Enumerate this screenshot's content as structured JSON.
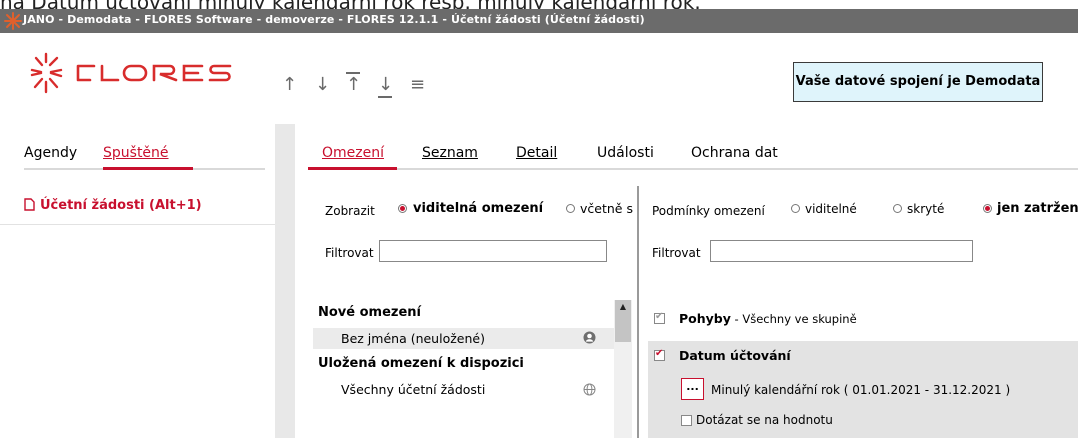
{
  "top_fragment": "na Datum účtování minulý kalendářní rok resp. minulý kalendářní rok.",
  "window": {
    "title": "JANO - Demodata - FLORES Software - demoverze - FLORES 12.1.1 - Účetní žádosti  (Účetní žádosti)"
  },
  "header": {
    "logo_text": "FLORES",
    "toolbar": [
      "up-arrow-icon",
      "down-arrow-icon",
      "move-to-top-icon",
      "move-to-bottom-icon",
      "menu-icon"
    ],
    "connection_label": "Vaše datové spojení je Demodata"
  },
  "left_panel": {
    "tabs": [
      {
        "label": "Agendy",
        "active": false
      },
      {
        "label": "Spuštěné",
        "active": true
      }
    ],
    "running_item": "Účetní žádosti (Alt+1)"
  },
  "main": {
    "tabs": [
      {
        "label": "Omezení",
        "active": true
      },
      {
        "label": "Seznam",
        "active": false
      },
      {
        "label": "Detail",
        "active": false
      },
      {
        "label": "Události",
        "active": false
      },
      {
        "label": "Ochrana dat",
        "active": false
      }
    ],
    "left": {
      "show_label": "Zobrazit",
      "show_options": [
        {
          "label": "viditelná omezení",
          "selected": true
        },
        {
          "label": "včetně s",
          "selected": false
        }
      ],
      "filter_label": "Filtrovat",
      "filter_value": "",
      "list": {
        "group1_title": "Nové omezení",
        "group1_item": "Bez jména (neuložené)",
        "group2_title": "Uložená omezení k dispozici",
        "group2_item": "Všechny účetní žádosti"
      }
    },
    "right": {
      "conditions_label": "Podmínky omezení",
      "condition_options": [
        {
          "label": "viditelné",
          "selected": false
        },
        {
          "label": "skryté",
          "selected": false
        },
        {
          "label": "jen zatržené",
          "selected": true
        }
      ],
      "filter_label": "Filtrovat",
      "filter_value": "",
      "conditions": [
        {
          "title": "Pohyby",
          "detail": " - Všechny ve skupině",
          "checked": true
        },
        {
          "title": "Datum účtování",
          "checked": true
        }
      ],
      "date_value": "Minulý kalendářní rok ( 01.01.2021 - 31.12.2021 )",
      "dots_label": "...",
      "ask_value_label": "Dotázat se na hodnotu"
    }
  },
  "colors": {
    "accent": "#c8102e",
    "titlebar": "#6b6b6b",
    "info_box": "#dff4fb"
  }
}
